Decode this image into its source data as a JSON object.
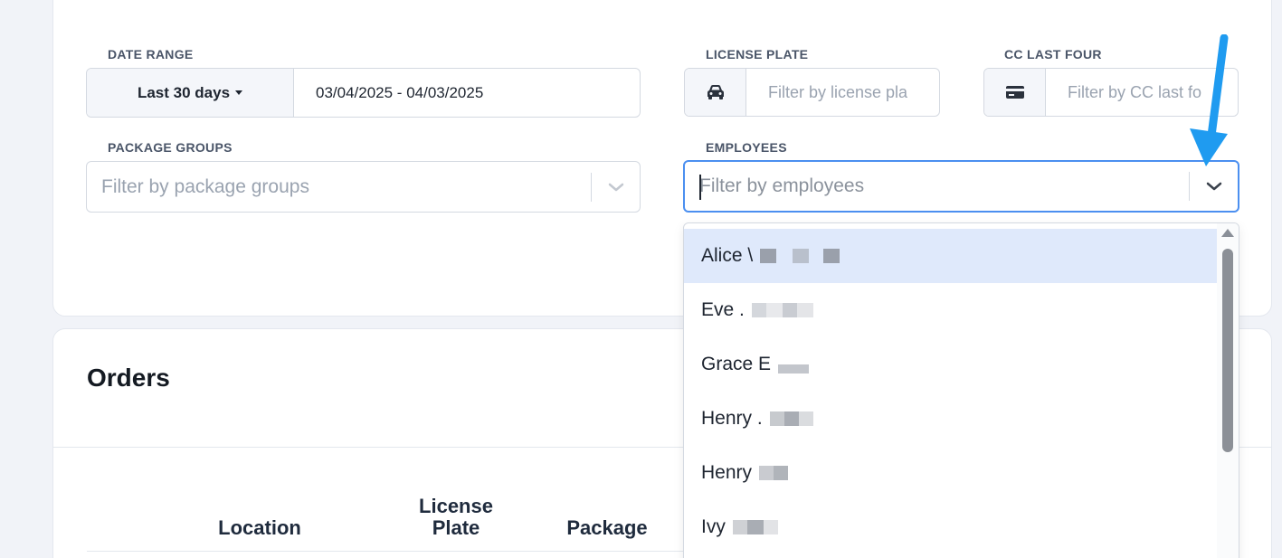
{
  "filters": {
    "date_range": {
      "label": "DATE RANGE",
      "preset": "Last 30 days",
      "value": "03/04/2025 - 04/03/2025"
    },
    "license_plate": {
      "label": "LICENSE PLATE",
      "placeholder": "Filter by license pla"
    },
    "cc_last_four": {
      "label": "CC LAST FOUR",
      "placeholder": "Filter by CC last fo"
    },
    "package_groups": {
      "label": "PACKAGE GROUPS",
      "placeholder": "Filter by package groups"
    },
    "employees": {
      "label": "EMPLOYEES",
      "placeholder": "Filter by employees"
    }
  },
  "employee_options": [
    {
      "label": "Alice \\"
    },
    {
      "label": "Eve ."
    },
    {
      "label": "Grace E"
    },
    {
      "label": "Henry ."
    },
    {
      "label": "Henry"
    },
    {
      "label": "Ivy"
    }
  ],
  "orders": {
    "title": "Orders",
    "columns": {
      "location": "Location",
      "license_plate_line1": "License",
      "license_plate_line2": "Plate",
      "package": "Package"
    }
  },
  "colors": {
    "accent": "#4b8ff0",
    "highlight": "#dfe9fb",
    "annotation_arrow": "#1f9bf0"
  },
  "icons": {
    "license_plate": "car-icon",
    "cc": "credit-card-icon",
    "dropdown": "chevron-down-icon"
  }
}
